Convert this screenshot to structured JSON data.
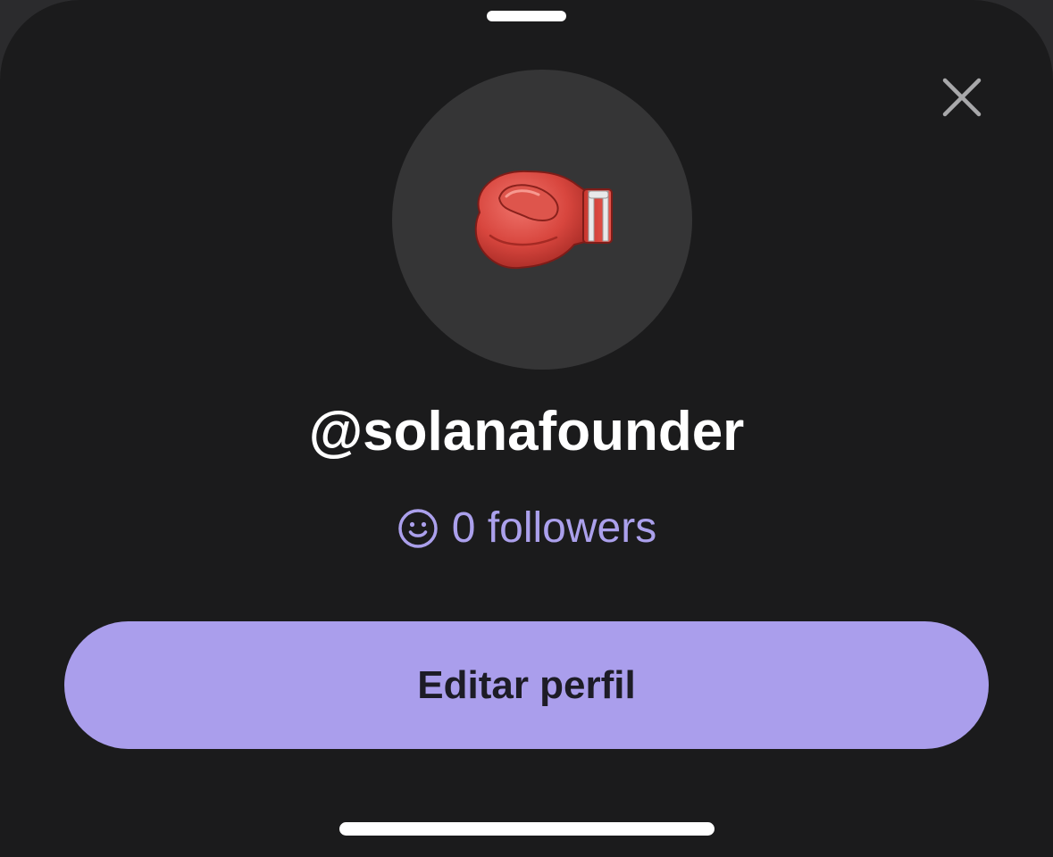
{
  "profile": {
    "avatar_icon": "boxing-glove-icon",
    "username": "@solanafounder",
    "followers_icon": "smiley-face-icon",
    "followers_text": "0 followers"
  },
  "actions": {
    "close_icon": "close-icon",
    "edit_label": "Editar perfil"
  },
  "colors": {
    "background": "#1b1b1c",
    "avatar_bg": "#353536",
    "accent": "#aba0ec",
    "button_bg": "#aa9eec",
    "button_text": "#1d1c26",
    "text": "#ffffff"
  }
}
